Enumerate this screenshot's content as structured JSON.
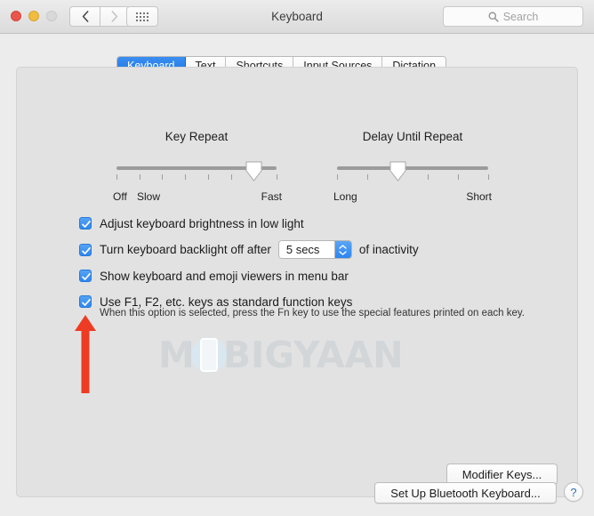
{
  "window": {
    "title": "Keyboard",
    "traffic_lights": [
      "close-red",
      "minimize-yellow",
      "zoom-disabled"
    ],
    "back_icon": "chevron-left-icon",
    "forward_icon": "chevron-right-icon",
    "grid_icon": "show-all-grid-icon"
  },
  "search": {
    "placeholder": "Search",
    "icon": "search-icon"
  },
  "tabs": [
    {
      "label": "Keyboard",
      "active": true
    },
    {
      "label": "Text",
      "active": false
    },
    {
      "label": "Shortcuts",
      "active": false
    },
    {
      "label": "Input Sources",
      "active": false
    },
    {
      "label": "Dictation",
      "active": false
    }
  ],
  "sliders": [
    {
      "title": "Key Repeat",
      "left_label": "Off",
      "second_label": "Slow",
      "right_label": "Fast",
      "ticks": 8,
      "value_index": 7,
      "value_percent": 86
    },
    {
      "title": "Delay Until Repeat",
      "left_label": "Long",
      "right_label": "Short",
      "ticks": 6,
      "value_index": 3,
      "value_percent": 40
    }
  ],
  "options": [
    {
      "label": "Adjust keyboard brightness in low light",
      "checked": true,
      "checkbox_icon": "checkmark-icon"
    },
    {
      "label": "Turn keyboard backlight off after",
      "label_after": "of inactivity",
      "checked": true,
      "checkbox_icon": "checkmark-icon",
      "combo_value": "5 secs",
      "stepper_icon": "stepper-up-down-icon"
    },
    {
      "label": "Show keyboard and emoji viewers in menu bar",
      "checked": true,
      "checkbox_icon": "checkmark-icon"
    },
    {
      "label": "Use F1, F2, etc. keys as standard function keys",
      "checked": true,
      "checkbox_icon": "checkmark-icon",
      "description": "When this option is selected, press the Fn key to use the special features printed on each key."
    }
  ],
  "buttons": {
    "modifier_keys": "Modifier Keys...",
    "bluetooth_keyboard": "Set Up Bluetooth Keyboard...",
    "help": "?"
  },
  "watermark": {
    "text_before": "M",
    "phone_icon": "smartphone-icon",
    "text_after": "BIGYAAN"
  },
  "annotation": {
    "arrow_icon": "red-up-arrow-icon",
    "arrow_color": "#ee3b24"
  },
  "colors": {
    "accent": "#2e86ef",
    "window_bg": "#ececec",
    "panel_bg": "#e2e2e2",
    "text": "#1b1b1b",
    "annotation_red": "#ee3b24",
    "watermark_gray": "#d2d6d9"
  }
}
